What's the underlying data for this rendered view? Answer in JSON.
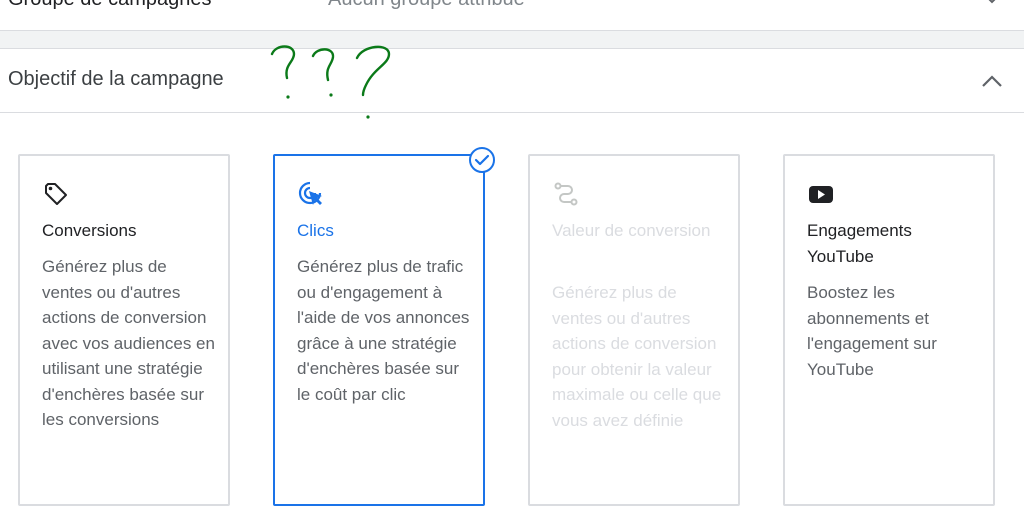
{
  "top_row": {
    "label": "Groupe de campagnes",
    "value": "Aucun groupe attribué"
  },
  "section": {
    "title": "Objectif de la campagne",
    "annotation": "???",
    "expanded": true
  },
  "cards": [
    {
      "icon": "tag-icon",
      "title": "Conversions",
      "description": "Générez plus de ventes ou d'autres actions de conversion avec vos audiences en utilisant une stratégie d'enchères basée sur les conversions",
      "state": "default"
    },
    {
      "icon": "click-icon",
      "title": "Clics",
      "description": "Générez plus de trafic ou d'engagement à l'aide de vos annonces grâce à une stratégie d'enchères basée sur le coût par clic",
      "state": "selected"
    },
    {
      "icon": "route-icon",
      "title": "Valeur de conversion",
      "description": "Générez plus de ventes ou d'autres actions de conversion pour obtenir la valeur maximale ou celle que vous avez définie",
      "state": "disabled"
    },
    {
      "icon": "youtube-icon",
      "title": "Engagements YouTube",
      "description": "Boostez les abonnements et l'engagement sur YouTube",
      "state": "default"
    }
  ],
  "colors": {
    "accent": "#1a73e8",
    "border": "#dadce0",
    "disabled_text": "#dadce0",
    "annotation": "#0b7a19"
  }
}
